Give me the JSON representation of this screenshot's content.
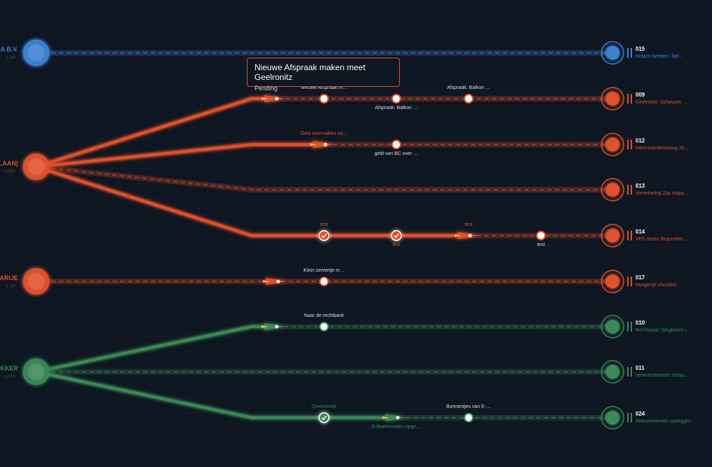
{
  "colors": {
    "blue": "#3d83d4",
    "orange": "#e2512a",
    "green": "#3a8a55",
    "background": "#0e1622"
  },
  "tooltip": {
    "title": "Nieuwe Afspraak maken meet Geelronitz",
    "status": "Pending"
  },
  "sources": [
    {
      "label": "CA B.V.",
      "sub": "1 job",
      "color": "blue"
    },
    {
      "label": "ILAAN)",
      "sub": "4 jobs",
      "color": "orange"
    },
    {
      "label": "GARIJE",
      "sub": "1 job",
      "color": "orange"
    },
    {
      "label": "AKKER",
      "sub": "3 jobs",
      "color": "green"
    }
  ],
  "lanes": [
    {
      "id": "015",
      "desc": "Notaris betalen / bel…",
      "color": "blue",
      "milestones": []
    },
    {
      "id": "009",
      "desc": "Geelronitz: Scheuren …",
      "color": "orange",
      "milestones": [
        {
          "label": "Nieuwe Afspraak m…",
          "label_pos": "above",
          "state": "open"
        },
        {
          "label": "Afspraak: Balkon …",
          "label_pos": "below",
          "state": "open"
        },
        {
          "label": "Afspraak: Balkon …",
          "label_pos": "above",
          "state": "open"
        }
      ]
    },
    {
      "id": "012",
      "desc": "Inkomstenbelasting 20…",
      "color": "orange",
      "milestones": [
        {
          "label": "Geld overmaken na…",
          "label_pos": "above",
          "state": "done-text"
        },
        {
          "label": "geld van BC over …",
          "label_pos": "below",
          "state": "open"
        }
      ]
    },
    {
      "id": "013",
      "desc": "Verzekering Zzp stopz…",
      "color": "orange",
      "milestones": []
    },
    {
      "id": "014",
      "desc": "VPS strato Stopzetten…",
      "color": "orange",
      "milestones": [
        {
          "label": "test",
          "label_pos": "above",
          "state": "done"
        },
        {
          "label": "test",
          "label_pos": "below",
          "state": "done"
        },
        {
          "label": "test",
          "label_pos": "above",
          "state": "done-text"
        },
        {
          "label": "test",
          "label_pos": "below",
          "state": "open"
        }
      ]
    },
    {
      "id": "017",
      "desc": "Hongerije checklist",
      "color": "orange",
      "milestones": [
        {
          "label": "Klein servertje m…",
          "label_pos": "above",
          "state": "open"
        }
      ]
    },
    {
      "id": "010",
      "desc": "Rechtzaak: Slegboom i…",
      "color": "green",
      "milestones": [
        {
          "label": "Naar de rechtbank",
          "label_pos": "above",
          "state": "open"
        }
      ]
    },
    {
      "id": "011",
      "desc": "Verkeersboetes: Schip…",
      "color": "green",
      "milestones": []
    },
    {
      "id": "024",
      "desc": "Abbonementen opzeggen",
      "color": "green",
      "milestones": [
        {
          "label": "Driversnote",
          "label_pos": "above",
          "state": "done"
        },
        {
          "label": "E-Boekhouden opge…",
          "label_pos": "below",
          "state": "done-text"
        },
        {
          "label": "Bonnentjes van E-…",
          "label_pos": "above",
          "state": "open"
        }
      ]
    }
  ]
}
